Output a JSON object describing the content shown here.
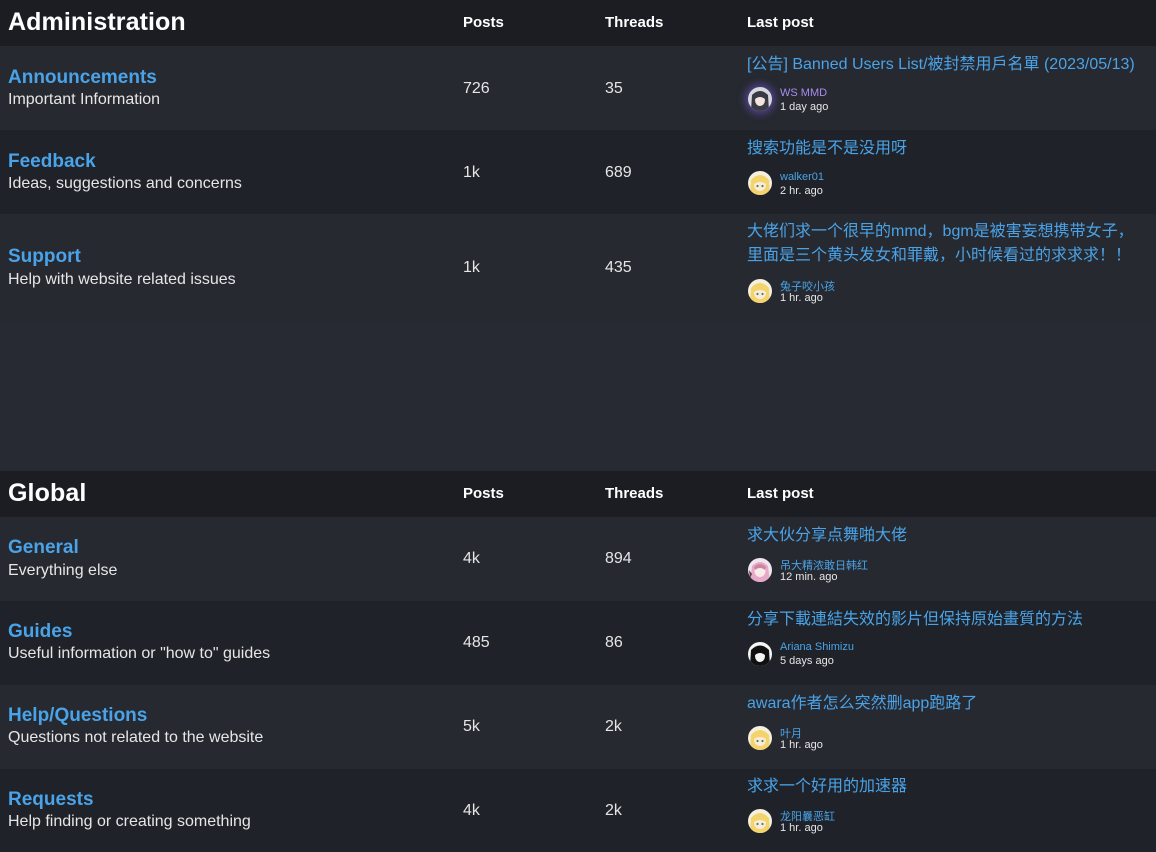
{
  "sections": [
    {
      "title": "Administration",
      "columns": {
        "posts": "Posts",
        "threads": "Threads",
        "last": "Last post"
      },
      "forums": [
        {
          "name": "Announcements",
          "desc": "Important Information",
          "posts": "726",
          "threads": "35",
          "last_title": "[公告] Banned Users List/被封禁用戶名單 (2023/05/13)",
          "last_user": "WS MMD",
          "last_user_color": "#a98cf0",
          "last_time": "1 day ago",
          "avatar": "dark-haired-avatar-icon"
        },
        {
          "name": "Feedback",
          "desc": "Ideas, suggestions and concerns",
          "posts": "1k",
          "threads": "689",
          "last_title": "搜索功能是不是没用呀",
          "last_user": "walker01",
          "last_time": "2 hr. ago",
          "avatar": "blonde-anime-avatar-icon"
        },
        {
          "name": "Support",
          "desc": "Help with website related issues",
          "posts": "1k",
          "threads": "435",
          "last_title": "大佬们求一个很早的mmd，bgm是被害妄想携带女子，里面是三个黄头发女和罪戴，小时候看过的求求求！！",
          "last_user": "兔子咬小孩",
          "last_time": "1 hr. ago",
          "avatar": "blonde-anime-avatar-icon"
        }
      ]
    },
    {
      "title": "Global",
      "columns": {
        "posts": "Posts",
        "threads": "Threads",
        "last": "Last post"
      },
      "forums": [
        {
          "name": "General",
          "desc": "Everything else",
          "posts": "4k",
          "threads": "894",
          "last_title": "求大伙分享点舞啪大佬",
          "last_user": "吊大精浓敢日韩红",
          "last_time": "12 min. ago",
          "avatar": "pink-anime-avatar-icon"
        },
        {
          "name": "Guides",
          "desc": "Useful information or \"how to\" guides",
          "posts": "485",
          "threads": "86",
          "last_title": "分享下載連結失效的影片但保持原始畫質的方法",
          "last_user": "Ariana Shimizu",
          "last_time": "5 days ago",
          "avatar": "monochrome-avatar-icon"
        },
        {
          "name": "Help/Questions",
          "desc": "Questions not related to the website",
          "posts": "5k",
          "threads": "2k",
          "last_title": "awara作者怎么突然删app跑路了",
          "last_user": "叶月",
          "last_time": "1 hr. ago",
          "avatar": "blonde-anime-avatar-icon"
        },
        {
          "name": "Requests",
          "desc": "Help finding or creating something",
          "posts": "4k",
          "threads": "2k",
          "last_title": "求求一个好用的加速器",
          "last_user": "龙阳曩恶缸",
          "last_time": "1 hr. ago",
          "avatar": "blonde-anime-avatar-icon"
        }
      ]
    }
  ]
}
